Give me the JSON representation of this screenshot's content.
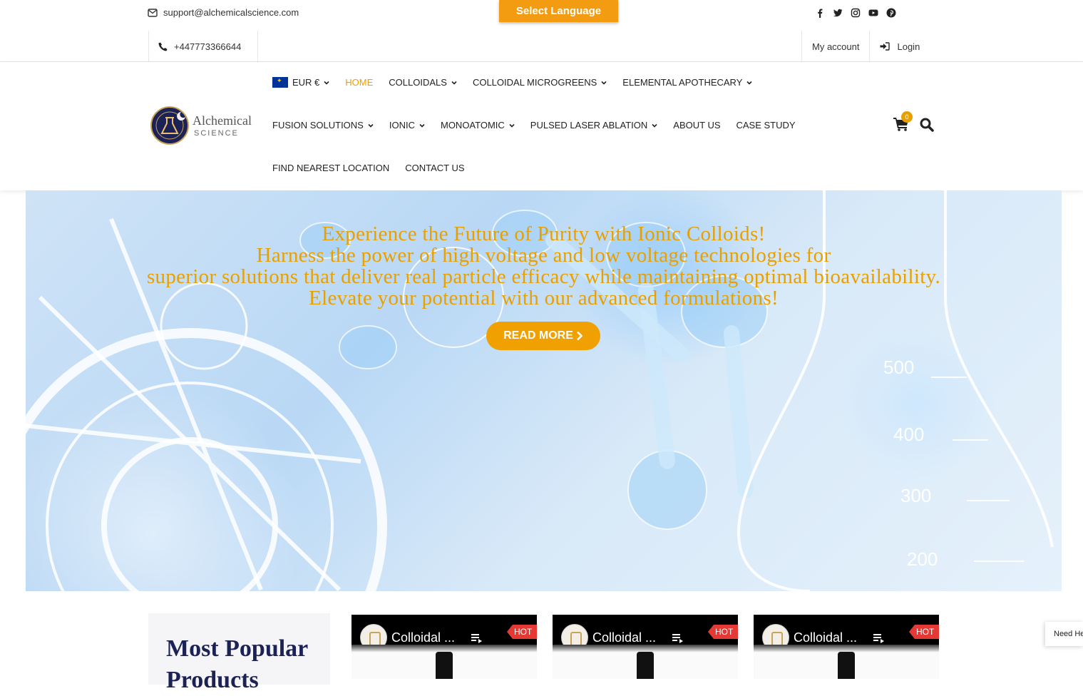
{
  "topbar": {
    "email": "support@alchemicalscience.com",
    "phone": "+447773366644",
    "language_button": "Select Language",
    "social_icons": [
      "facebook-icon",
      "twitter-icon",
      "instagram-icon",
      "youtube-icon",
      "pinterest-icon"
    ],
    "my_account": "My account",
    "login": "Login"
  },
  "logo": {
    "line1": "Alchemical",
    "line2": "SCIENCE"
  },
  "nav": {
    "currency": "EUR €",
    "row1": [
      {
        "label": "HOME",
        "active": true,
        "dropdown": false
      },
      {
        "label": "COLLOIDALS",
        "dropdown": true
      },
      {
        "label": "COLLOIDAL MICROGREENS",
        "dropdown": true
      },
      {
        "label": "ELEMENTAL APOTHECARY",
        "dropdown": true
      }
    ],
    "row2": [
      {
        "label": "FUSION SOLUTIONS",
        "dropdown": true
      },
      {
        "label": "IONIC",
        "dropdown": true
      },
      {
        "label": "MONOATOMIC",
        "dropdown": true
      },
      {
        "label": "PULSED LASER ABLATION",
        "dropdown": true
      },
      {
        "label": "ABOUT US",
        "dropdown": false
      },
      {
        "label": "CASE STUDY",
        "dropdown": false
      }
    ],
    "row3": [
      {
        "label": "FIND NEAREST LOCATION",
        "dropdown": false
      },
      {
        "label": "CONTACT US",
        "dropdown": false
      }
    ],
    "cart_count": "0"
  },
  "hero": {
    "line1": "Experience the Future of Purity with Ionic Colloids!",
    "line2": "Harness the power of high voltage and low voltage technologies for",
    "line3": "superior solutions that deliver real particle efficacy while maintaining optimal bioavailability.",
    "line4": "Elevate your potential with our advanced formulations!",
    "button": "READ MORE",
    "scale_labels": [
      "500",
      "400",
      "300",
      "200"
    ]
  },
  "section": {
    "heading": "Most Popular Products",
    "cards": [
      {
        "title": "Colloidal ...",
        "badge": "HOT"
      },
      {
        "title": "Colloidal ...",
        "badge": "HOT"
      },
      {
        "title": "Colloidal ...",
        "badge": "HOT"
      }
    ]
  },
  "help_widget": "Need Help?",
  "colors": {
    "accent": "#e8a000",
    "navy": "#1c2255",
    "hot": "#e53935"
  }
}
